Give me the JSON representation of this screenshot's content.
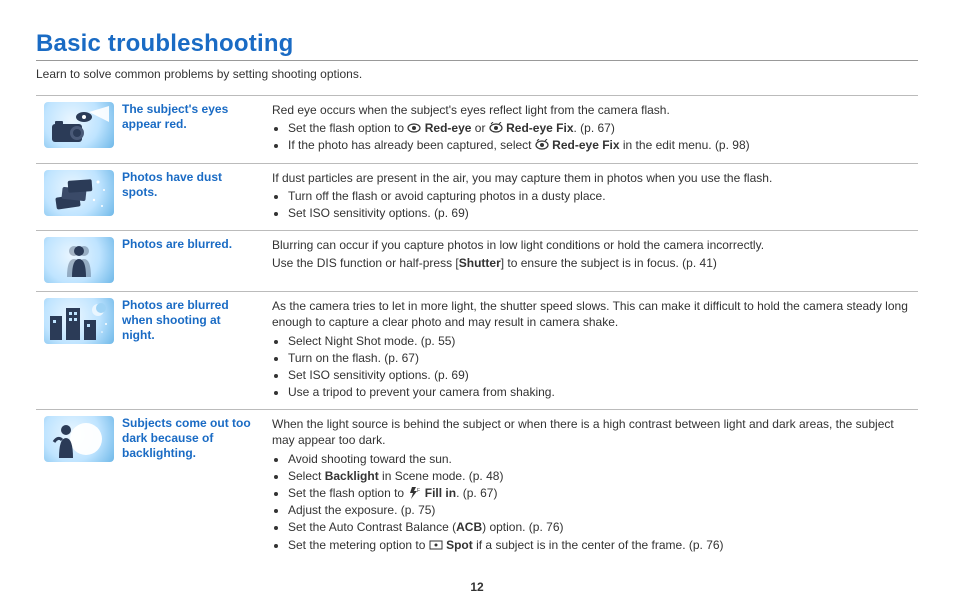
{
  "title": "Basic troubleshooting",
  "intro": "Learn to solve common problems by setting shooting options.",
  "page_number": "12",
  "rows": [
    {
      "label": "The subject's eyes appear red.",
      "lead": "Red eye occurs when the subject's eyes reflect light from the camera flash.",
      "b1_a": "Set the flash option to ",
      "b1_b": " Red-eye",
      "b1_c": " or ",
      "b1_d": " Red-eye Fix",
      "b1_e": ". (p. 67)",
      "b2_a": "If the photo has already been captured, select ",
      "b2_b": " Red-eye Fix",
      "b2_c": " in the edit menu. (p. 98)"
    },
    {
      "label": "Photos have dust spots.",
      "lead": "If dust particles are present in the air, you may capture them in photos when you use the flash.",
      "b1": "Turn off the flash or avoid capturing photos in a dusty place.",
      "b2": "Set ISO sensitivity options. (p. 69)"
    },
    {
      "label": "Photos are blurred.",
      "lead1": "Blurring can occur if you capture photos in low light conditions or hold the camera incorrectly.",
      "lead2_a": "Use the DIS function or half-press [",
      "lead2_b": "Shutter",
      "lead2_c": "] to ensure the subject is in focus. (p. 41)"
    },
    {
      "label": "Photos are blurred when shooting at night.",
      "lead": "As the camera tries to let in more light, the shutter speed slows. This can make it difficult to hold the camera steady long enough to capture a clear photo and may result in camera shake.",
      "b1": "Select Night Shot mode. (p. 55)",
      "b2": "Turn on the flash. (p. 67)",
      "b3": "Set ISO sensitivity options. (p. 69)",
      "b4": "Use a tripod to prevent your camera from shaking."
    },
    {
      "label": "Subjects come out too dark because of backlighting.",
      "lead": "When the light source is behind the subject or when there is a high contrast between light and dark areas, the subject may appear too dark.",
      "b1": "Avoid shooting toward the sun.",
      "b2_a": "Select ",
      "b2_b": "Backlight",
      "b2_c": " in Scene mode. (p. 48)",
      "b3_a": "Set the flash option to ",
      "b3_b": " Fill in",
      "b3_c": ". (p. 67)",
      "b4": "Adjust the exposure. (p. 75)",
      "b5_a": "Set the Auto Contrast Balance (",
      "b5_b": "ACB",
      "b5_c": ") option. (p. 76)",
      "b6_a": "Set the metering option to ",
      "b6_b": " Spot",
      "b6_c": " if a subject is in the center of the frame. (p. 76)"
    }
  ]
}
